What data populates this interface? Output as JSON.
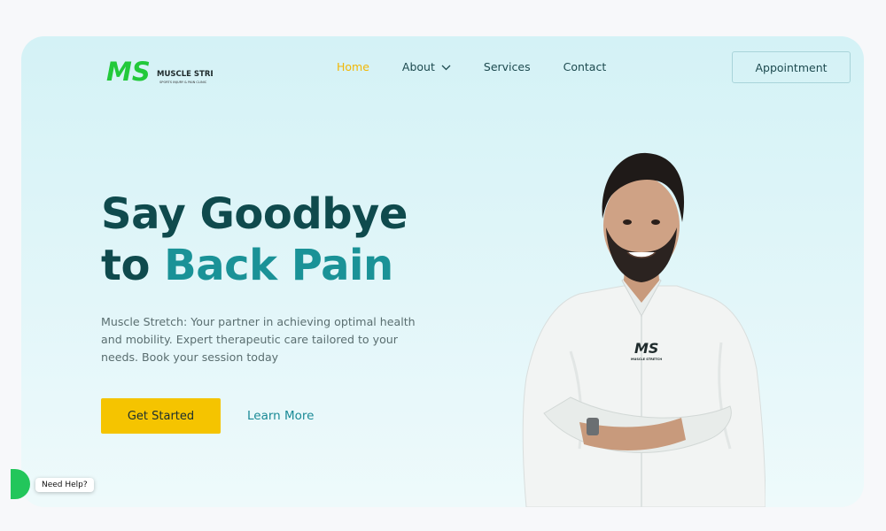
{
  "brand": {
    "logo_letters": "MS",
    "logo_name": "MUSCLE STRETCH",
    "logo_tagline": "SPORTS INJURY & PAIN CLINIC",
    "colors": {
      "green": "#22c93a",
      "dark": "#1f2b2c",
      "accent": "#1a9297",
      "yellow": "#f5c400"
    }
  },
  "nav": {
    "items": [
      {
        "label": "Home",
        "active": true
      },
      {
        "label": "About",
        "has_dropdown": true,
        "icon": "chevron-down-icon"
      },
      {
        "label": "Services"
      },
      {
        "label": "Contact"
      }
    ],
    "cta_label": "Appointment"
  },
  "hero": {
    "title_line1": "Say Goodbye",
    "title_line2_prefix": "to",
    "title_line2_accent": "Back Pain",
    "description": "Muscle Stretch: Your partner in achieving optimal health and mobility. Expert therapeutic care tailored to your needs. Book your session today",
    "primary_button": "Get Started",
    "secondary_link": "Learn More",
    "shirt_logo": "MS",
    "shirt_logo_name": "MUSCLE STRETCH"
  },
  "help": {
    "label": "Need Help?"
  }
}
